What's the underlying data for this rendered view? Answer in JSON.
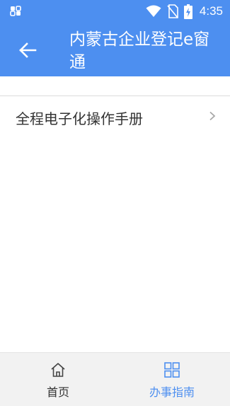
{
  "status_bar": {
    "time": "4:35",
    "icons": [
      "notification-icon",
      "wifi-icon",
      "no-sim-icon",
      "battery-charging-icon"
    ]
  },
  "header": {
    "title": "内蒙古企业登记e窗通",
    "back_icon": "arrow-left-icon",
    "background_color": "#4d8ff0"
  },
  "list": {
    "items": [
      {
        "label": "全程电子化操作手册",
        "icon": "chevron-right-icon"
      }
    ]
  },
  "bottom_nav": {
    "tabs": [
      {
        "label": "首页",
        "icon": "home-icon",
        "active": false
      },
      {
        "label": "办事指南",
        "icon": "grid-icon",
        "active": true
      }
    ],
    "active_color": "#4d8ff0"
  }
}
